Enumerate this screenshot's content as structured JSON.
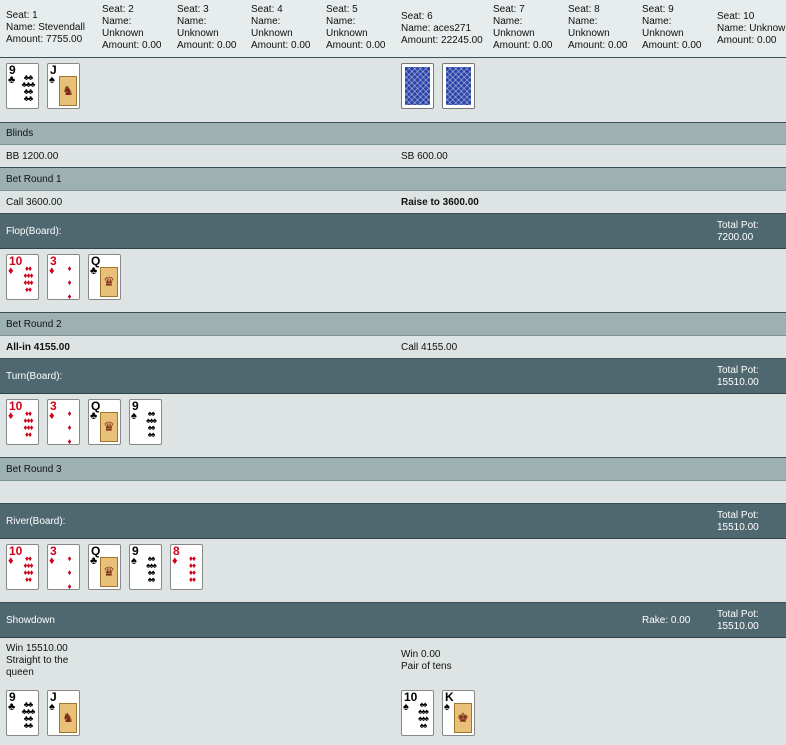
{
  "seats": [
    {
      "seat": "Seat: 1",
      "name": "Name: Stevendall",
      "amount": "Amount: 7755.00"
    },
    {
      "seat": "Seat: 2",
      "name": "Name:",
      "name2": "Unknown",
      "amount": "Amount: 0.00"
    },
    {
      "seat": "Seat: 3",
      "name": "Name:",
      "name2": "Unknown",
      "amount": "Amount: 0.00"
    },
    {
      "seat": "Seat: 4",
      "name": "Name:",
      "name2": "Unknown",
      "amount": "Amount: 0.00"
    },
    {
      "seat": "Seat: 5",
      "name": "Name:",
      "name2": "Unknown",
      "amount": "Amount: 0.00"
    },
    {
      "seat": "Seat: 6",
      "name": "Name: aces271",
      "amount": "Amount: 22245.00"
    },
    {
      "seat": "Seat: 7",
      "name": "Name:",
      "name2": "Unknown",
      "amount": "Amount: 0.00"
    },
    {
      "seat": "Seat: 8",
      "name": "Name:",
      "name2": "Unknown",
      "amount": "Amount: 0.00"
    },
    {
      "seat": "Seat: 9",
      "name": "Name:",
      "name2": "Unknown",
      "amount": "Amount: 0.00"
    },
    {
      "seat": "Seat: 10",
      "name": "Name: Unknown",
      "amount": "Amount: 0.00"
    }
  ],
  "hole_cards": {
    "seat1": [
      {
        "rank": "9",
        "suit": "♣",
        "color": "blk"
      },
      {
        "rank": "J",
        "suit": "♠",
        "color": "blk"
      }
    ],
    "seat6_hidden": true
  },
  "blinds": {
    "header": "Blinds",
    "left": "BB 1200.00",
    "right": "SB 600.00"
  },
  "round1": {
    "header": "Bet Round 1",
    "left": "Call 3600.00",
    "right": "Raise to 3600.00"
  },
  "flop": {
    "header": "Flop(Board):",
    "pot_label": "Total Pot:",
    "pot_value": "7200.00"
  },
  "round2": {
    "header": "Bet Round 2",
    "left": "All-in 4155.00",
    "right": "Call 4155.00"
  },
  "turn": {
    "header": "Turn(Board):",
    "pot_label": "Total Pot:",
    "pot_value": "15510.00"
  },
  "round3": {
    "header": "Bet Round 3"
  },
  "river": {
    "header": "River(Board):",
    "pot_label": "Total Pot:",
    "pot_value": "15510.00"
  },
  "showdown": {
    "header": "Showdown",
    "rake": "Rake: 0.00",
    "pot_label": "Total Pot:",
    "pot_value": "15510.00"
  },
  "results": {
    "left_win": "Win 15510.00",
    "left_hand1": "Straight to the",
    "left_hand2": "queen",
    "right_win": "Win 0.00",
    "right_hand": "Pair of tens"
  },
  "board": {
    "ten_d": {
      "rank": "10",
      "suit": "♦"
    },
    "three_d": {
      "rank": "3",
      "suit": "♦"
    },
    "queen_c": {
      "rank": "Q",
      "suit": "♣"
    },
    "nine_s": {
      "rank": "9",
      "suit": "♠"
    },
    "eight_d": {
      "rank": "8",
      "suit": "♦"
    }
  },
  "showdown_cards": {
    "seat1": [
      {
        "rank": "9",
        "suit": "♣"
      },
      {
        "rank": "J",
        "suit": "♠"
      }
    ],
    "seat6": [
      {
        "rank": "10",
        "suit": "♠"
      },
      {
        "rank": "K",
        "suit": "♠"
      }
    ]
  }
}
